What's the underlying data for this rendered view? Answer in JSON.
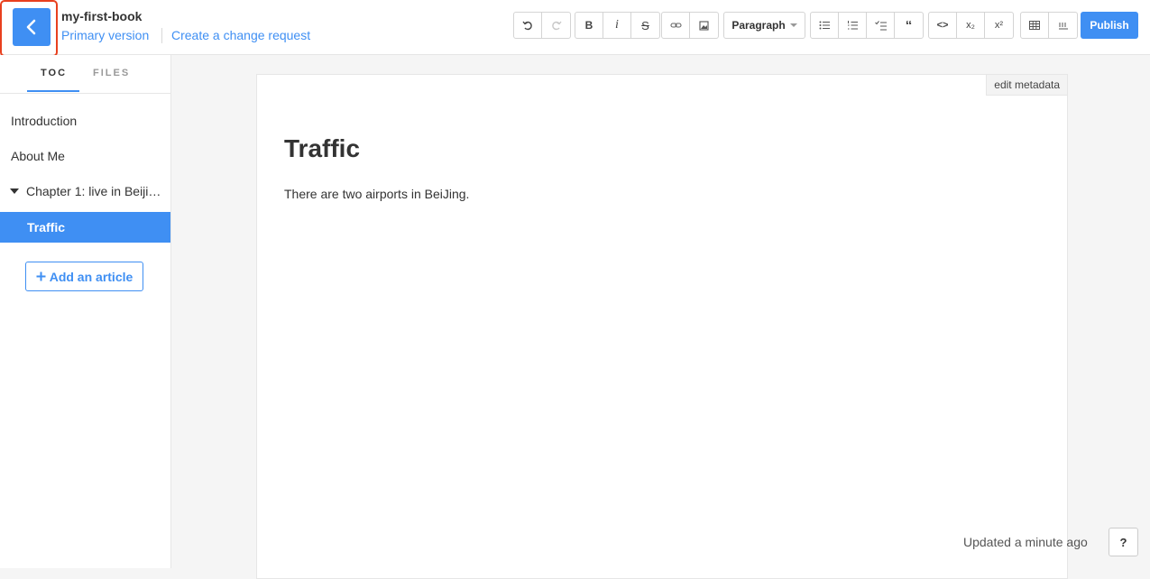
{
  "header": {
    "book_title": "my-first-book",
    "version_label": "Primary version",
    "change_request_label": "Create a change request",
    "publish_label": "Publish"
  },
  "toolbar": {
    "paragraph_label": "Paragraph",
    "bold_label": "B",
    "italic_label": "i",
    "strike_label": "S",
    "code_label": "<>",
    "subscript_label": "x₂",
    "superscript_label": "x²",
    "quote_label": "“",
    "icons": [
      "undo-icon",
      "redo-icon",
      "bold-icon",
      "italic-icon",
      "strikethrough-icon",
      "link-icon",
      "image-icon",
      "bullet-list-icon",
      "numbered-list-icon",
      "task-list-icon",
      "quote-icon",
      "code-icon",
      "subscript-icon",
      "superscript-icon",
      "table-icon",
      "math-icon"
    ]
  },
  "sidebar": {
    "tabs": [
      {
        "label": "TOC"
      },
      {
        "label": "FILES"
      }
    ],
    "items": [
      {
        "label": "Introduction"
      },
      {
        "label": "About Me"
      },
      {
        "label": "Chapter 1: live in Beiji…"
      },
      {
        "label": "Traffic"
      }
    ],
    "add_article_label": "Add an article"
  },
  "editor": {
    "edit_metadata_label": "edit metadata",
    "title": "Traffic",
    "body": "There are two airports in BeiJing."
  },
  "footer": {
    "updated_label": "Updated a minute ago",
    "help_label": "?"
  },
  "colors": {
    "accent": "#3f8ff3",
    "highlight_border": "#e8401e"
  }
}
